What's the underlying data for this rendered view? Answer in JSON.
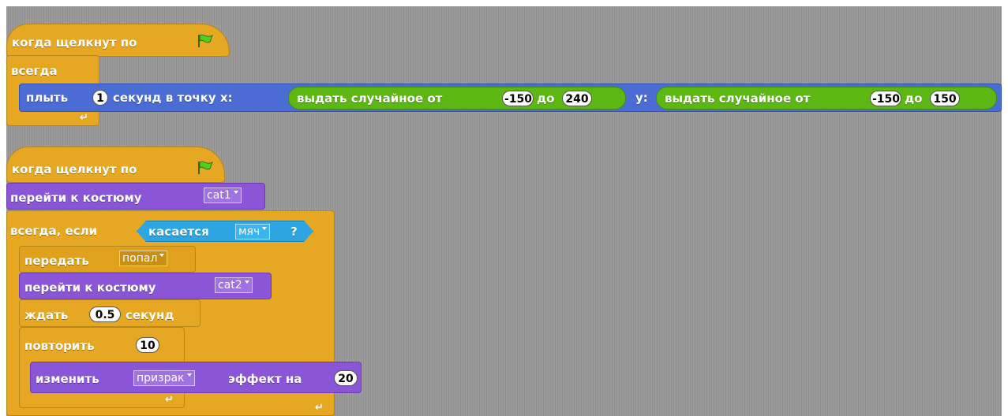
{
  "script1": {
    "hat_label": "когда щелкнут по",
    "forever_label": "всегда",
    "glide": {
      "prefix": "плыть",
      "secs": "1",
      "mid": "секунд в точку x:",
      "y_label": "y:",
      "x_random": {
        "from_label": "выдать случайное от",
        "from": "-150",
        "to_label": "до",
        "to": "240"
      },
      "y_random": {
        "from_label": "выдать случайное от",
        "from": "-150",
        "to_label": "до",
        "to": "150"
      }
    }
  },
  "script2": {
    "hat_label": "когда щелкнут по",
    "switch_costume1": {
      "label": "перейти к костюму",
      "value": "cat1"
    },
    "forever_if": {
      "label": "всегда, если",
      "sensing_label": "касается",
      "sensing_value": "мяч",
      "q": "?"
    },
    "broadcast": {
      "label": "передать",
      "value": "попал"
    },
    "switch_costume2": {
      "label": "перейти к костюму",
      "value": "cat2"
    },
    "wait": {
      "label": "ждать",
      "value": "0.5",
      "unit": "секунд"
    },
    "repeat": {
      "label": "повторить",
      "value": "10"
    },
    "change_effect": {
      "label": "изменить",
      "value": "призрак",
      "mid": "эффект на",
      "amount": "20"
    }
  },
  "colors": {
    "control": "#e6a822",
    "looks": "#8a55d7",
    "motion": "#4a6cd4",
    "operators": "#5cb712",
    "sensing": "#2ca5e2",
    "canvas": "#9a9a9a"
  },
  "icons": {
    "green_flag": "green-flag-icon",
    "loop_arrow": "loop-arrow-icon"
  }
}
